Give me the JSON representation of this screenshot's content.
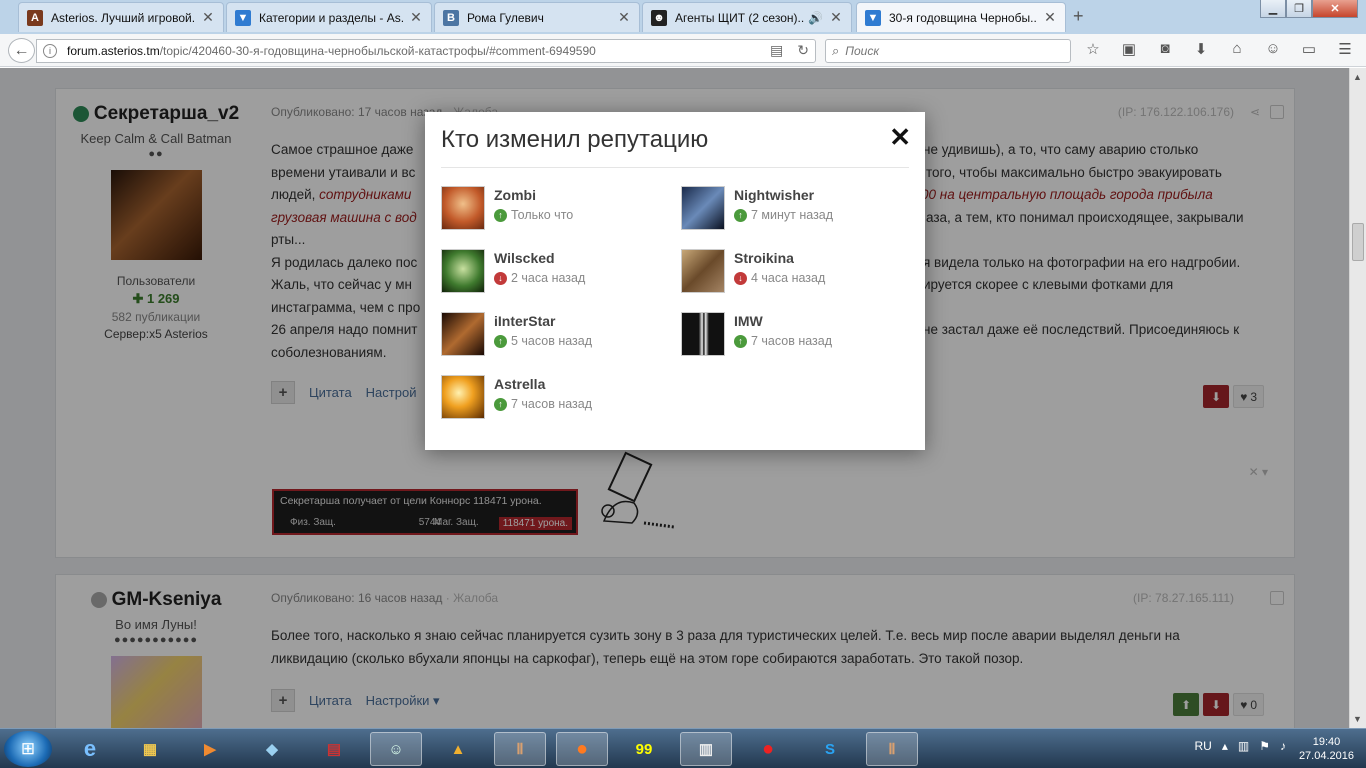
{
  "browser": {
    "tabs": [
      {
        "title": "Asterios. Лучший игровой...",
        "icon": "asterios-favicon",
        "color": "#7a3a1e"
      },
      {
        "title": "Категории и разделы - As...",
        "icon": "forum-favicon",
        "color": "#2f7bd1"
      },
      {
        "title": "Рома Гулевич",
        "icon": "vk-favicon",
        "color": "#4c75a3"
      },
      {
        "title": "Агенты ЩИТ (2 сезон)...",
        "icon": "agents-favicon",
        "color": "#222222"
      },
      {
        "title": "30-я годовщина Чернобы...",
        "icon": "forum-favicon",
        "color": "#2f7bd1"
      }
    ],
    "url_domain": "forum.asterios.tm",
    "url_rest": "/topic/420460-30-я-годовщина-чернобыльской-катастрофы/#comment-6949590",
    "url_prefix": "",
    "search_placeholder": "Поиск"
  },
  "posts": [
    {
      "author": "Секретарша_v2",
      "status_color": "#2e8b57",
      "title": "Keep Calm & Call Batman",
      "pips": "●●",
      "group": "Пользователи",
      "reputation": "1 269",
      "publications": "582 публикации",
      "server": "Сервер:x5 Asterios",
      "published": "Опубликовано: 17 часов назад",
      "report": "· Жалоба",
      "ip": "(IP: 176.122.106.176)",
      "text_line1": "Самое страшное даже",
      "text_line1_right": "не удивишь), а то, что саму аварию столько",
      "text_line2_left": "времени утаивали и вс",
      "text_line2_right": "того, чтобы максимально быстро эвакуировать",
      "text_line3_left": "людей,",
      "text_line3_em": "сотрудниками",
      "text_line3_right_em": "00 на центральную площадь города прибыла",
      "text_line4_em": "грузовая машина с вод",
      "text_line4_right": "аза, а тем, кто понимал происходящее, закрывали",
      "text_line5": "рты...",
      "text_line6_left": "Я родилась далеко пос",
      "text_line6_right": "я видела только на фотографии на его надгробии.",
      "text_line7_left": "Жаль, что сейчас  у мн",
      "text_line7_right": "ируется скорее с клевыми фотками для",
      "text_line8_left": "инстаграмма, чем с про",
      "text_line9_left": "26 апреля надо помнит",
      "text_line9_right": "не застал даже её последствий. Присоединяюсь к",
      "text_line10": "соболезнованиям.",
      "action_quote": "Цитата",
      "action_settings": "Настрой",
      "vote_count": "3",
      "sig_text": "Секретарша получает от цели Коннорс 118471 урона.",
      "sig_def": "Физ. Защ.",
      "sig_def_val": "5744",
      "sig_mdef": "Маг. Защ.",
      "sig_dmg": "118471 урона."
    },
    {
      "author": "GM-Kseniya",
      "status_color": "#aaaaaa",
      "title": "Во имя Луны!",
      "pips": "●●●●●●●●●●●",
      "published": "Опубликовано: 16 часов назад",
      "report": "· Жалоба",
      "ip": "(IP: 78.27.165.111)",
      "text_line1": "Более того, насколько я знаю сейчас планируется сузить зону в 3 раза для туристических целей. Т.е. весь мир после аварии выделял деньги на",
      "text_line2": "ликвидацию (сколько вбухали японцы на саркофаг), теперь ещё на этом горе собираются заработать. Это такой позор.",
      "action_quote": "Цитата",
      "action_settings": "Настройки",
      "vote_count": "0"
    }
  ],
  "modal": {
    "title": "Кто изменил репутацию",
    "items": [
      {
        "name": "Zombi",
        "time": "Только что",
        "dir": "up",
        "avatar_color": "#d06030"
      },
      {
        "name": "Nightwisher",
        "time": "7 минут назад",
        "dir": "up",
        "avatar_color": "#2a3a5a"
      },
      {
        "name": "Wilscked",
        "time": "2 часа назад",
        "dir": "down",
        "avatar_color": "#3f7a2e"
      },
      {
        "name": "Stroikina",
        "time": "4 часа назад",
        "dir": "down",
        "avatar_color": "#8a6a4a"
      },
      {
        "name": "iInterStar",
        "time": "5 часов назад",
        "dir": "up",
        "avatar_color": "#3a2010"
      },
      {
        "name": "IMW",
        "time": "7 часов назад",
        "dir": "up",
        "avatar_color": "#111111"
      },
      {
        "name": "Astrella",
        "time": "7 часов назад",
        "dir": "up",
        "avatar_color": "#e8901a"
      }
    ]
  },
  "taskbar": {
    "apps": [
      "ie",
      "explorer",
      "media",
      "notes",
      "archive",
      "messenger",
      "game",
      "game2",
      "firefox",
      "99",
      "video",
      "record",
      "skype",
      "lineage"
    ],
    "lang": "RU",
    "time": "19:40",
    "date": "27.04.2016"
  }
}
